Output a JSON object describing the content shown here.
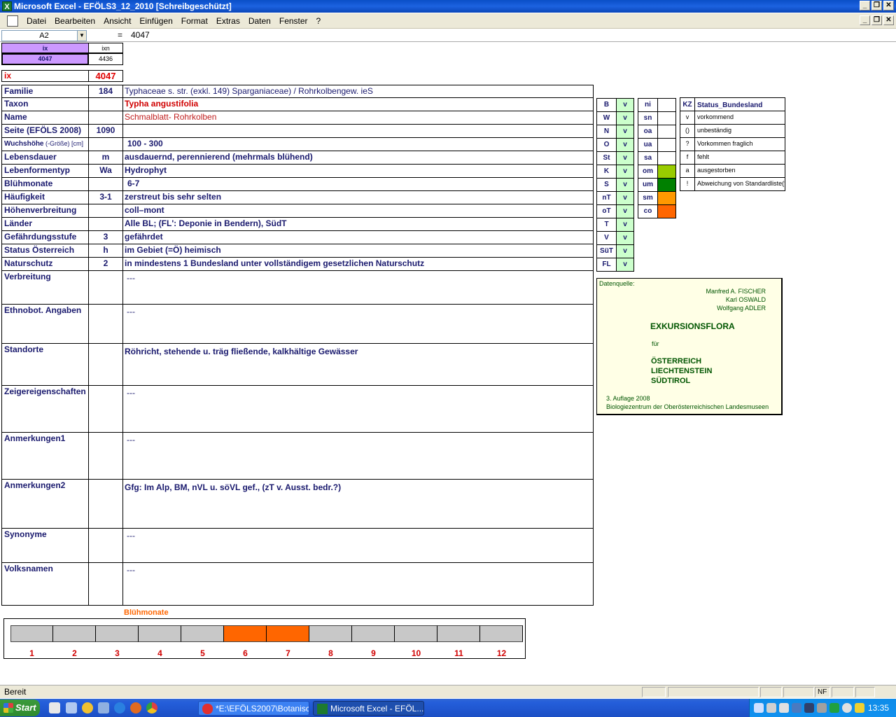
{
  "window": {
    "title": "Microsoft Excel - EFÖLS3_12_2010  [Schreibgeschützt]",
    "btn_min": "_",
    "btn_max": "❐",
    "btn_close": "✕"
  },
  "menu": {
    "items": [
      "Datei",
      "Bearbeiten",
      "Ansicht",
      "Einfügen",
      "Format",
      "Extras",
      "Daten",
      "Fenster",
      "?"
    ]
  },
  "formula": {
    "name_box": "A2",
    "eq": "=",
    "value": "4047"
  },
  "top": {
    "ix_header": "ix",
    "ixn_header": "ixn",
    "ix_value": "4047",
    "ixn_value": "4436",
    "ix_label": "ix",
    "ix_big": "4047"
  },
  "rows": [
    {
      "label": "Familie",
      "code": "184",
      "text": "Typhaceae s. str. (exkl. 149) Sparganiaceae)  /  Rohrkolbengew. ieS"
    },
    {
      "label": "Taxon",
      "code": "",
      "text": "Typha angustifolia"
    },
    {
      "label": "Name",
      "code": "",
      "text": "Schmalblatt- Rohrkolben"
    },
    {
      "label": "Seite (EFÖLS 2008)",
      "code": "1090",
      "text": ""
    },
    {
      "label": "Wuchshöhe",
      "label_small": " (-Größe) [cm]",
      "code": "",
      "text": "100 - 300"
    },
    {
      "label": "Lebensdauer",
      "code": "m",
      "text": "ausdauernd, perennierend (mehrmals blühend)"
    },
    {
      "label": "Lebenformentyp",
      "code": "Wa",
      "text": "Hydrophyt"
    },
    {
      "label": "Blühmonate",
      "code": "",
      "text": "6-7"
    },
    {
      "label": "Häufigkeit",
      "code": "3-1",
      "text": "zerstreut bis sehr selten"
    },
    {
      "label": "Höhenverbreitung",
      "code": "",
      "text": "coll–mont"
    },
    {
      "label": "Länder",
      "code": "",
      "text": "Alle BL; (FL': Deponie in Bendern), SüdT"
    },
    {
      "label": "Gefährdungsstufe",
      "code": "3",
      "text": "gefährdet"
    },
    {
      "label": "Status Österreich",
      "code": "h",
      "text": "im Gebiet (=Ö) heimisch"
    },
    {
      "label": "Naturschutz",
      "code": "2",
      "text": "in mindestens 1 Bundesland unter vollständigem gesetzlichen Naturschutz"
    }
  ],
  "big_rows": [
    {
      "label": "Verbreitung",
      "text": "---"
    },
    {
      "label": "Ethnobot. Angaben",
      "text": "---"
    },
    {
      "label": "Standorte",
      "text": "Röhricht, stehende u. träg fließende, kalkhältige Gewässer"
    },
    {
      "label": "Zeigereigenschaften",
      "text": "---"
    },
    {
      "label": "Anmerkungen1",
      "text": "---"
    },
    {
      "label": "Anmerkungen2",
      "text": "Gfg: Im Alp, BM, nVL u. söVL gef., (zT v. Ausst. bedr.?)"
    },
    {
      "label": "Synonyme",
      "text": "---"
    },
    {
      "label": "Volksnamen",
      "text": "---"
    }
  ],
  "states": {
    "codes": [
      "B",
      "W",
      "N",
      "O",
      "St",
      "K",
      "S",
      "nT",
      "oT",
      "T",
      "V",
      "SüT",
      "FL"
    ],
    "values": [
      "v",
      "v",
      "v",
      "v",
      "v",
      "v",
      "v",
      "v",
      "v",
      "v",
      "v",
      "v",
      "v"
    ]
  },
  "heights": {
    "codes": [
      "ni",
      "sn",
      "oa",
      "ua",
      "sa",
      "om",
      "um",
      "sm",
      "co"
    ],
    "colors": [
      "",
      "",
      "",
      "",
      "",
      "#99cc00",
      "#008000",
      "#ff9900",
      "#ff6600"
    ]
  },
  "legend": {
    "kz_header": "KZ",
    "status_header": "Status_Bundesland",
    "items": [
      {
        "code": "v",
        "text": "vorkommend"
      },
      {
        "code": "()",
        "text": "unbeständig"
      },
      {
        "code": "?",
        "text": "Vorkommen fraglich"
      },
      {
        "code": "f",
        "text": "fehlt"
      },
      {
        "code": "a",
        "text": "ausgestorben"
      },
      {
        "code": "!",
        "text": "Abweichung von Standardliste(?)"
      }
    ]
  },
  "source": {
    "label": "Datenquelle:",
    "authors": [
      "Manfred A. FISCHER",
      "Karl OSWALD",
      "Wolfgang ADLER"
    ],
    "title": "EXKURSIONSFLORA",
    "fuer": "für",
    "countries": [
      "ÖSTERREICH",
      "LIECHTENSTEIN",
      "SÜDTIROL"
    ],
    "edition": "3. Auflage 2008",
    "publisher": "Biologiezentrum der Oberösterreichischen Landesmuseen"
  },
  "months": {
    "title": "Blühmonate",
    "labels": [
      "1",
      "2",
      "3",
      "4",
      "5",
      "6",
      "7",
      "8",
      "9",
      "10",
      "11",
      "12"
    ],
    "flowering": [
      false,
      false,
      false,
      false,
      false,
      true,
      true,
      false,
      false,
      false,
      false,
      false
    ],
    "color_on": "#ff6600",
    "color_off": "#c8c8c8"
  },
  "statusbar": {
    "text": "Bereit",
    "nf": "NF"
  },
  "taskbar": {
    "start": "Start",
    "task1": "*E:\\EFÖLS2007\\Botanisc...",
    "task2": "Microsoft Excel - EFÖL...",
    "clock": "13:35"
  }
}
